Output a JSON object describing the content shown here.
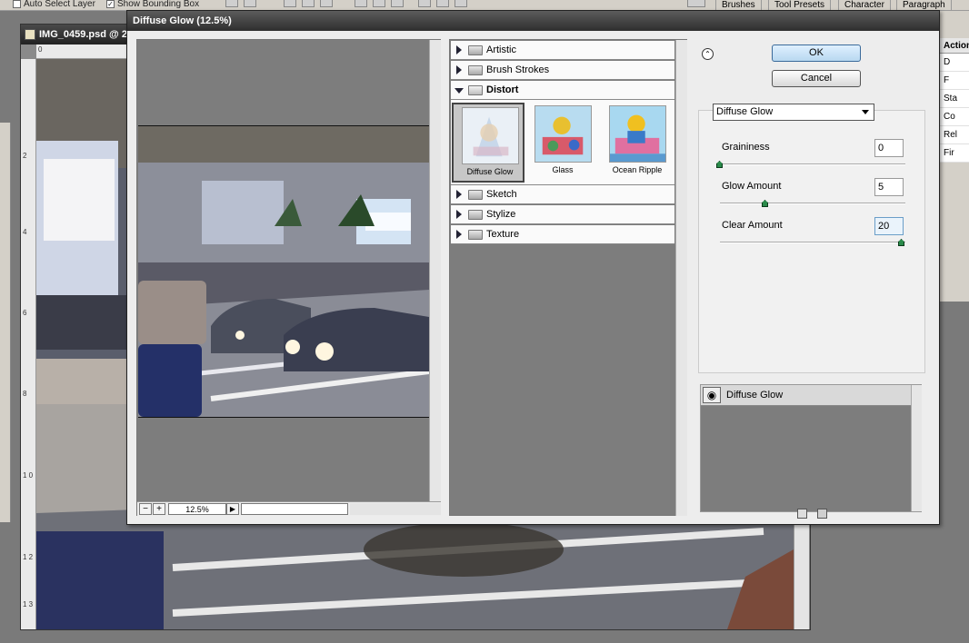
{
  "options_bar": {
    "auto_select_layer": "Auto Select Layer",
    "show_bounding_box": "Show Bounding Box"
  },
  "panel_tabs": [
    "Brushes",
    "Tool Presets",
    "Character",
    "Paragraph"
  ],
  "document": {
    "title": "IMG_0459.psd @ 2",
    "ruler_h": [
      "0"
    ],
    "ruler_v": [
      "2",
      "4",
      "6",
      "8",
      "1 0",
      "1 2",
      "1 3"
    ]
  },
  "actions_panel": {
    "title": "Actions",
    "items": [
      "D",
      "F",
      "Sta",
      "Co",
      "Rel",
      "Fir"
    ]
  },
  "dialog": {
    "title": "Diffuse Glow (12.5%)",
    "zoom": "12.5%",
    "zoom_minus": "−",
    "zoom_plus": "+",
    "categories": {
      "artistic": "Artistic",
      "brush_strokes": "Brush Strokes",
      "distort": "Distort",
      "sketch": "Sketch",
      "stylize": "Stylize",
      "texture": "Texture"
    },
    "distort_filters": [
      "Diffuse Glow",
      "Glass",
      "Ocean Ripple"
    ],
    "ok": "OK",
    "cancel": "Cancel",
    "selected_filter": "Diffuse Glow",
    "params": {
      "graininess": {
        "label": "Graininess",
        "value": "0",
        "fraction": 0.0
      },
      "glow_amount": {
        "label": "Glow Amount",
        "value": "5",
        "fraction": 0.25
      },
      "clear_amount": {
        "label": "Clear Amount",
        "value": "20",
        "fraction": 1.0
      }
    },
    "layer_name": "Diffuse Glow"
  },
  "colors": {
    "dialog_bg": "#ededed",
    "accent_ok": "#b8d8f0",
    "slider_knob": "#2a8a4a"
  }
}
